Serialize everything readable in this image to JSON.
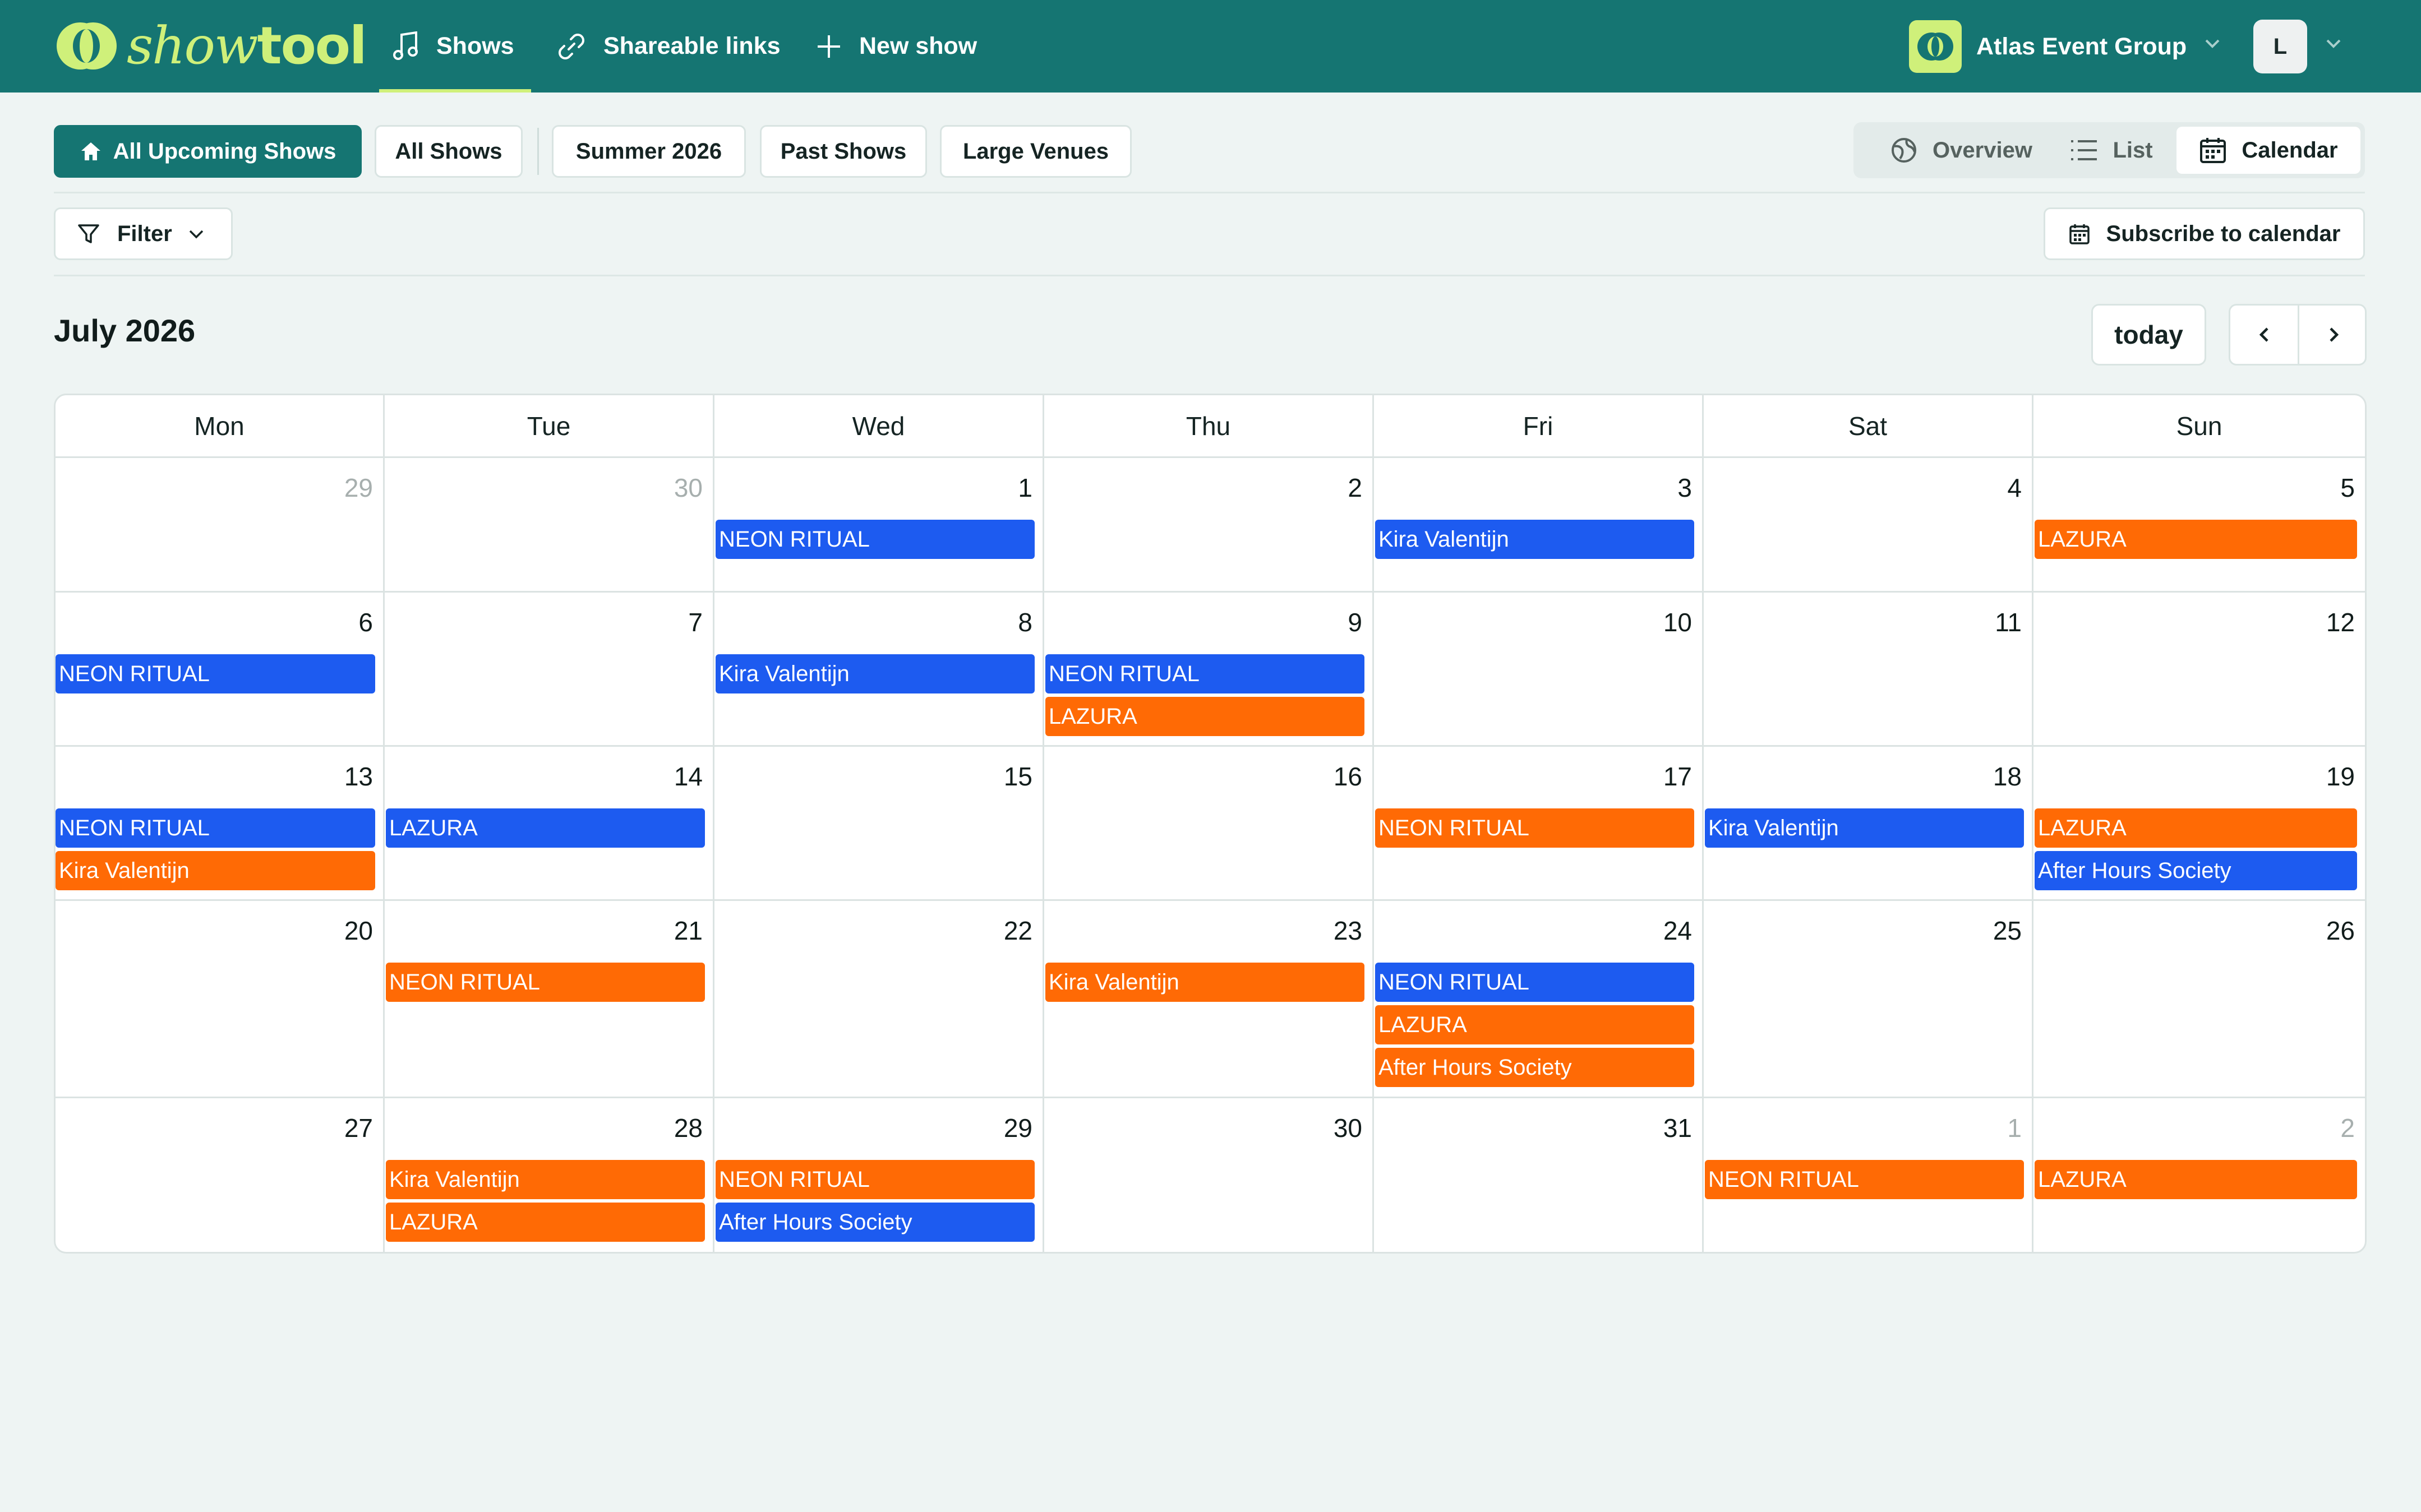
{
  "app": {
    "logo_light": "show",
    "logo_bold": "tool",
    "nav": [
      {
        "label": "Shows",
        "icon": "music-note-icon"
      },
      {
        "label": "Shareable links",
        "icon": "link-icon"
      },
      {
        "label": "New show",
        "icon": "plus-icon"
      }
    ],
    "org_name": "Atlas Event Group",
    "avatar_initial": "L"
  },
  "views": {
    "pills": [
      "All Upcoming Shows",
      "All Shows",
      "Summer 2026",
      "Past Shows",
      "Large Venues"
    ],
    "active_pill": "All Upcoming Shows",
    "modes": [
      "Overview",
      "List",
      "Calendar"
    ],
    "active_mode": "Calendar"
  },
  "toolbar": {
    "filter_label": "Filter",
    "subscribe_label": "Subscribe to calendar"
  },
  "calendar": {
    "month_title": "July 2026",
    "today_label": "today",
    "weekdays": [
      "Mon",
      "Tue",
      "Wed",
      "Thu",
      "Fri",
      "Sat",
      "Sun"
    ],
    "colors": {
      "blue": "#1d5bf0",
      "orange": "#ff6a05",
      "brand": "#157572",
      "accent": "#cff07a"
    },
    "weeks": [
      [
        {
          "day": "29",
          "muted": true,
          "events": []
        },
        {
          "day": "30",
          "muted": true,
          "events": []
        },
        {
          "day": "1",
          "events": [
            {
              "title": "NEON RITUAL",
              "color": "blue"
            }
          ]
        },
        {
          "day": "2",
          "events": []
        },
        {
          "day": "3",
          "events": [
            {
              "title": "Kira Valentijn",
              "color": "blue"
            }
          ]
        },
        {
          "day": "4",
          "events": []
        },
        {
          "day": "5",
          "events": [
            {
              "title": "LAZURA",
              "color": "orange"
            }
          ]
        }
      ],
      [
        {
          "day": "6",
          "events": [
            {
              "title": "NEON RITUAL",
              "color": "blue"
            }
          ]
        },
        {
          "day": "7",
          "events": []
        },
        {
          "day": "8",
          "events": [
            {
              "title": "Kira Valentijn",
              "color": "blue"
            }
          ]
        },
        {
          "day": "9",
          "events": [
            {
              "title": "NEON RITUAL",
              "color": "blue"
            },
            {
              "title": "LAZURA",
              "color": "orange"
            }
          ]
        },
        {
          "day": "10",
          "events": []
        },
        {
          "day": "11",
          "events": []
        },
        {
          "day": "12",
          "events": []
        }
      ],
      [
        {
          "day": "13",
          "events": [
            {
              "title": "NEON RITUAL",
              "color": "blue"
            },
            {
              "title": "Kira Valentijn",
              "color": "orange"
            }
          ]
        },
        {
          "day": "14",
          "events": [
            {
              "title": "LAZURA",
              "color": "blue"
            }
          ]
        },
        {
          "day": "15",
          "events": []
        },
        {
          "day": "16",
          "events": []
        },
        {
          "day": "17",
          "events": [
            {
              "title": "NEON RITUAL",
              "color": "orange"
            }
          ]
        },
        {
          "day": "18",
          "events": [
            {
              "title": "Kira Valentijn",
              "color": "blue"
            }
          ]
        },
        {
          "day": "19",
          "events": [
            {
              "title": "LAZURA",
              "color": "orange"
            },
            {
              "title": "After Hours Society",
              "color": "blue"
            }
          ]
        }
      ],
      [
        {
          "day": "20",
          "events": []
        },
        {
          "day": "21",
          "events": [
            {
              "title": "NEON RITUAL",
              "color": "orange"
            }
          ]
        },
        {
          "day": "22",
          "events": []
        },
        {
          "day": "23",
          "events": [
            {
              "title": "Kira Valentijn",
              "color": "orange"
            }
          ]
        },
        {
          "day": "24",
          "events": [
            {
              "title": "NEON RITUAL",
              "color": "blue"
            },
            {
              "title": "LAZURA",
              "color": "orange"
            },
            {
              "title": "After Hours Society",
              "color": "orange"
            }
          ]
        },
        {
          "day": "25",
          "events": []
        },
        {
          "day": "26",
          "events": []
        }
      ],
      [
        {
          "day": "27",
          "events": []
        },
        {
          "day": "28",
          "events": [
            {
              "title": "Kira Valentijn",
              "color": "orange"
            },
            {
              "title": "LAZURA",
              "color": "orange"
            }
          ]
        },
        {
          "day": "29",
          "events": [
            {
              "title": "NEON RITUAL",
              "color": "orange"
            },
            {
              "title": "After Hours Society",
              "color": "blue"
            }
          ]
        },
        {
          "day": "30",
          "events": []
        },
        {
          "day": "31",
          "events": []
        },
        {
          "day": "1",
          "muted": true,
          "events": [
            {
              "title": "NEON RITUAL",
              "color": "orange"
            }
          ]
        },
        {
          "day": "2",
          "muted": true,
          "events": [
            {
              "title": "LAZURA",
              "color": "orange"
            }
          ]
        }
      ]
    ]
  }
}
